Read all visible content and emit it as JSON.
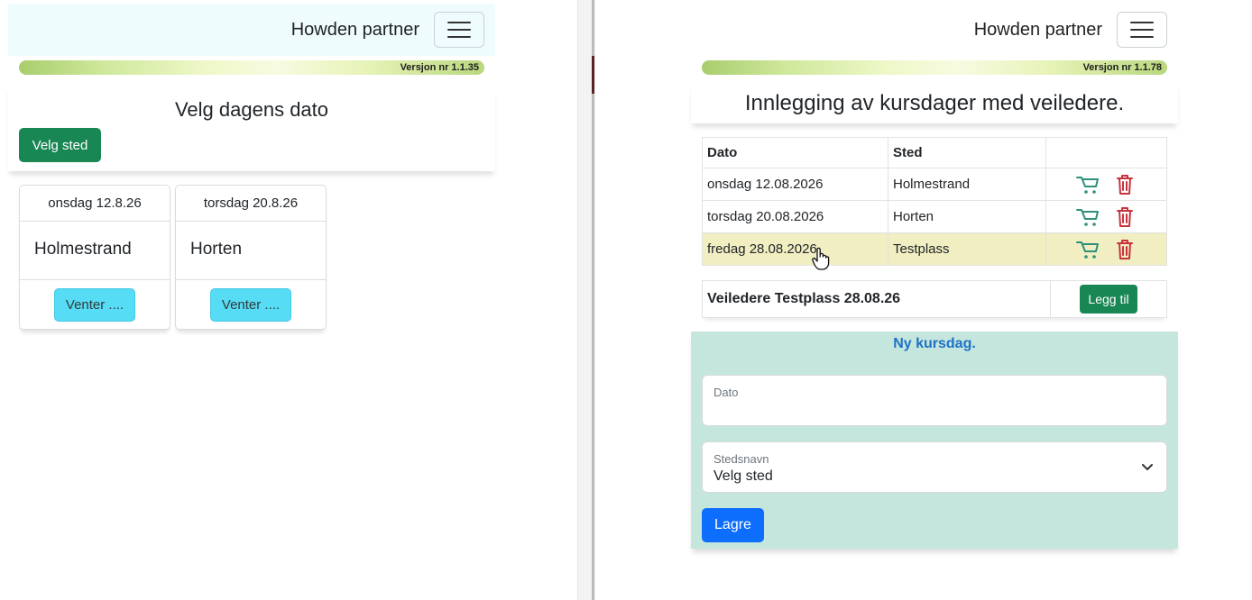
{
  "left": {
    "brand": "Howden partner",
    "version": "Versjon nr 1.1.35",
    "heading": "Velg dagens dato",
    "select_place_button": "Velg sted",
    "days": [
      {
        "date": "onsdag 12.8.26",
        "place": "Holmestrand",
        "status": "Venter ...."
      },
      {
        "date": "torsdag 20.8.26",
        "place": "Horten",
        "status": "Venter ...."
      }
    ]
  },
  "right": {
    "brand": "Howden partner",
    "version": "Versjon nr 1.1.78",
    "heading": "Innlegging av kursdager med veiledere.",
    "table": {
      "headers": [
        "Dato",
        "Sted",
        ""
      ],
      "rows": [
        {
          "date": "onsdag 12.08.2026",
          "place": "Holmestrand"
        },
        {
          "date": "torsdag 20.08.2026",
          "place": "Horten"
        },
        {
          "date": "fredag 28.08.2026",
          "place": "Testplass"
        }
      ]
    },
    "veiledere": {
      "label": "Veiledere Testplass 28.08.26",
      "add_button": "Legg til"
    },
    "form": {
      "title": "Ny kursdag.",
      "date_label": "Dato",
      "date_value": "",
      "place_label": "Stedsnavn",
      "place_value": "Velg sted",
      "save_button": "Lagre"
    }
  },
  "colors": {
    "green": "#198754",
    "cyan": "#57dcf5",
    "blue": "#0d6efd",
    "form_bg": "#c4e6dd",
    "selected_row": "#f1eec2",
    "trash": "#c8323c",
    "cart": "#2f8f7a"
  },
  "icons": [
    "menu-icon",
    "cart-icon",
    "trash-icon",
    "chevron-down-icon",
    "hand-cursor-icon"
  ]
}
